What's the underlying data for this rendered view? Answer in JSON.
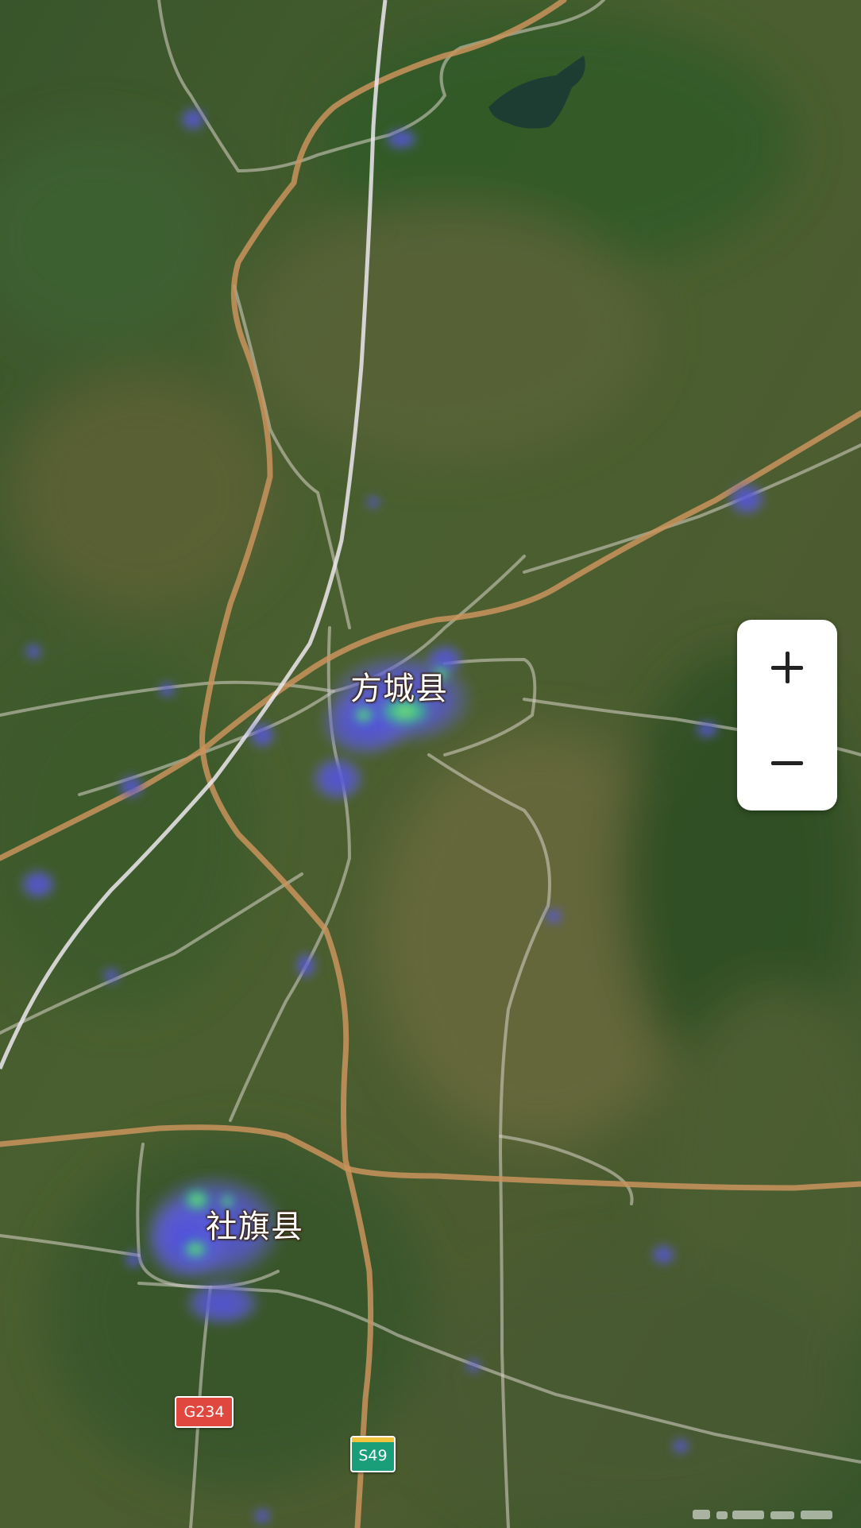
{
  "map": {
    "type": "satellite-heatmap",
    "labels": {
      "fangcheng": "方城县",
      "sheqi": "社旗县"
    },
    "road_shields": {
      "national": "G234",
      "provincial": "S49"
    },
    "colors": {
      "expressway": "#c9935c",
      "road": "#d8d4c8",
      "railway": "#ece8ee",
      "heat_low": "#5b5bd6",
      "heat_high": "#3ecf7a",
      "shield_national": "#e0473f",
      "shield_provincial": "#1a9e7a"
    }
  },
  "controls": {
    "zoom_in_icon": "plus-icon",
    "zoom_out_icon": "minus-icon"
  }
}
